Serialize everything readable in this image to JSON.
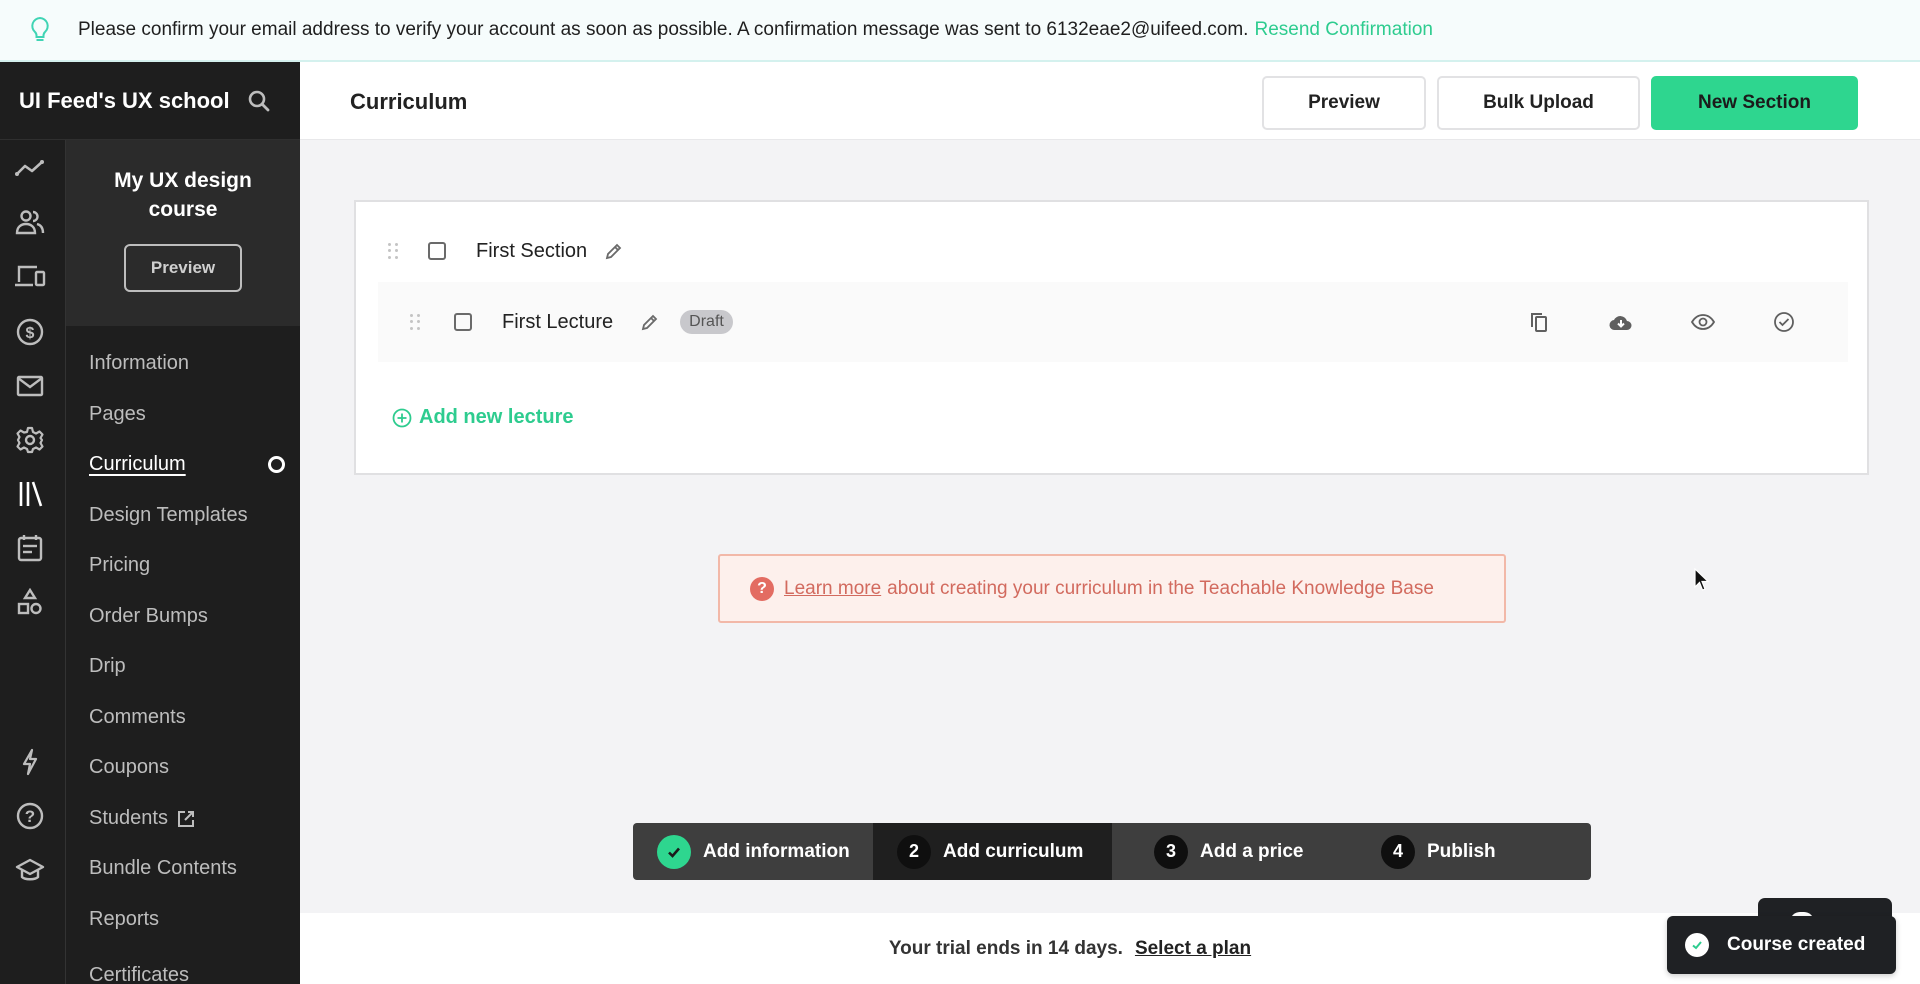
{
  "banner": {
    "icon": "lightbulb-icon",
    "message": "Please confirm your email address to verify your account as soon as possible. A confirmation message was sent to 6132eae2@uifeed.com.",
    "resend_label": "Resend Confirmation"
  },
  "school": {
    "name": "UI Feed's UX school",
    "search_icon": "search-icon"
  },
  "rail_icons": [
    "analytics-icon",
    "users-icon",
    "devices-icon",
    "dollar-icon",
    "mail-icon",
    "gear-icon",
    "library-icon",
    "calendar-icon",
    "shapes-icon",
    "lightning-icon",
    "help-icon",
    "graduation-cap-icon"
  ],
  "course": {
    "title": "My UX design course",
    "preview_label": "Preview"
  },
  "nav": {
    "items": [
      {
        "label": "Information"
      },
      {
        "label": "Pages"
      },
      {
        "label": "Curriculum",
        "active": true
      },
      {
        "label": "Design Templates"
      },
      {
        "label": "Pricing"
      },
      {
        "label": "Order Bumps"
      },
      {
        "label": "Drip"
      },
      {
        "label": "Comments"
      },
      {
        "label": "Coupons"
      },
      {
        "label": "Students",
        "external": true
      },
      {
        "label": "Bundle Contents"
      },
      {
        "label": "Reports"
      },
      {
        "label": "Certificates"
      }
    ]
  },
  "header": {
    "title": "Curriculum",
    "preview_label": "Preview",
    "bulk_upload_label": "Bulk Upload",
    "new_section_label": "New Section"
  },
  "curriculum": {
    "section": {
      "title": "First Section"
    },
    "lecture": {
      "title": "First Lecture",
      "status": "Draft",
      "actions": [
        "copy-icon",
        "cloud-download-icon",
        "eye-icon",
        "check-circle-icon"
      ]
    },
    "add_lecture_label": "Add new lecture"
  },
  "info": {
    "link_label": "Learn more",
    "text": "about creating your curriculum in the Teachable Knowledge Base"
  },
  "stepper": {
    "steps": [
      {
        "number": "",
        "label": "Add information",
        "state": "done"
      },
      {
        "number": "2",
        "label": "Add curriculum",
        "state": "current"
      },
      {
        "number": "3",
        "label": "Add a price",
        "state": "todo"
      },
      {
        "number": "4",
        "label": "Publish",
        "state": "todo"
      }
    ]
  },
  "trial": {
    "text": "Your trial ends in 14 days.",
    "link_label": "Select a plan"
  },
  "toast": {
    "message": "Course created"
  },
  "colors": {
    "accent": "#2ed68f",
    "sidebar_bg": "#1e1e1e",
    "info_text": "#d26a5e"
  }
}
